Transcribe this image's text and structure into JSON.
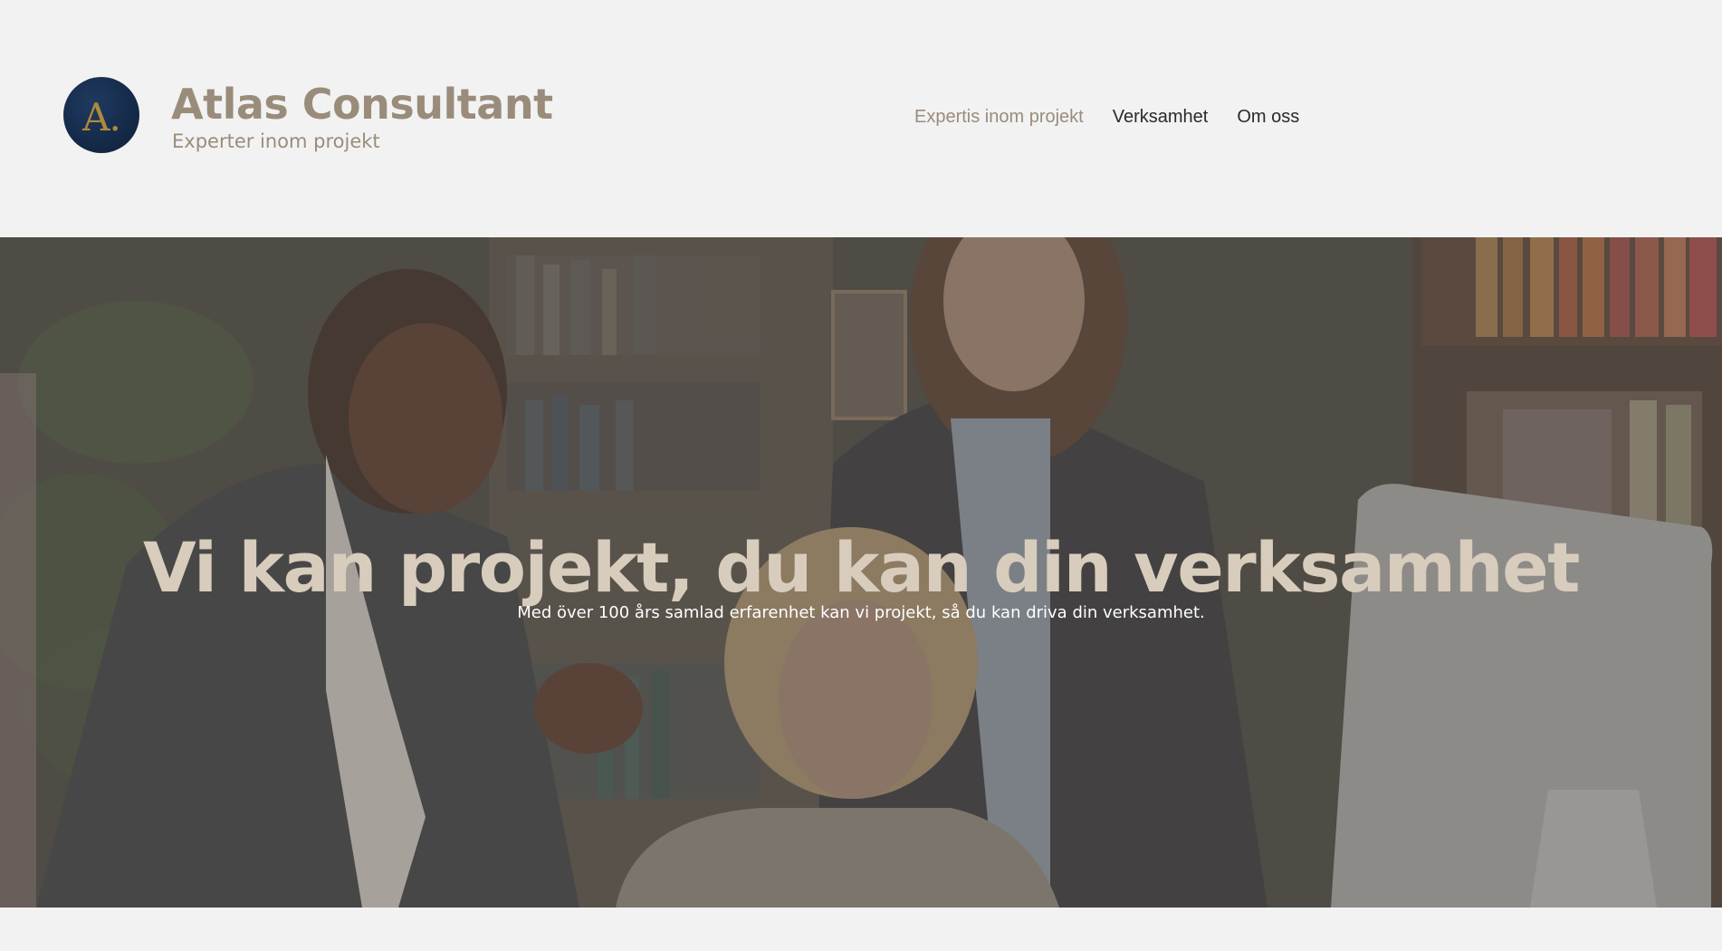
{
  "header": {
    "logo_letter": "A.",
    "brand_title": "Atlas Consultant",
    "brand_tagline": "Experter inom projekt"
  },
  "nav": {
    "items": [
      {
        "label": "Expertis inom projekt",
        "active": true
      },
      {
        "label": "Verksamhet",
        "active": false
      },
      {
        "label": "Om oss",
        "active": false
      }
    ]
  },
  "hero": {
    "title": "Vi kan projekt, du kan din verksamhet",
    "subtitle": "Med över 100 års samlad erfarenhet kan vi projekt, så du kan driva din verksamhet."
  },
  "colors": {
    "brand_text": "#9a8c7b",
    "logo_bg": "#152a49",
    "logo_gold": "#b08a3a",
    "hero_title": "#d8ccbd"
  }
}
